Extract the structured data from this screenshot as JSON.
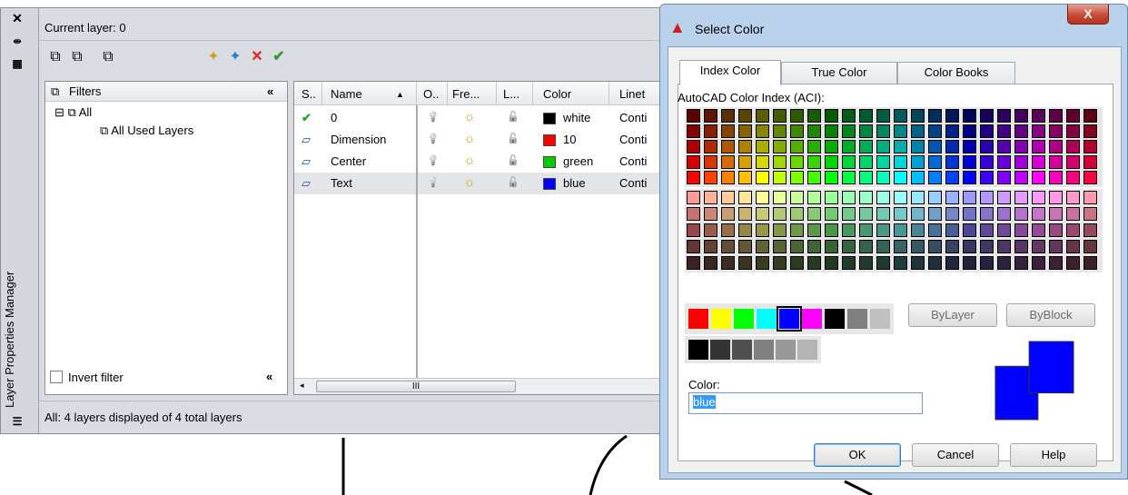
{
  "lpm": {
    "vertical_title": "Layer Properties Manager",
    "current_layer": "Current layer: 0",
    "filters_header": "Filters",
    "tree": {
      "root": "All",
      "child": "All Used Layers"
    },
    "invert_filter": "Invert filter",
    "columns": [
      "S..",
      "Name",
      "O..",
      "Fre...",
      "L...",
      "Color",
      "Linet"
    ],
    "layers": [
      {
        "status": "✔",
        "name": "0",
        "color_name": "white",
        "color_hex": "#000000",
        "linetype": "Conti"
      },
      {
        "status": "▱",
        "name": "Dimension",
        "color_name": "10",
        "color_hex": "#ff0000",
        "linetype": "Conti"
      },
      {
        "status": "▱",
        "name": "Center",
        "color_name": "green",
        "color_hex": "#00cc00",
        "linetype": "Conti"
      },
      {
        "status": "▱",
        "name": "Text",
        "color_name": "blue",
        "color_hex": "#0000ff",
        "linetype": "Conti"
      }
    ],
    "scroll_thumb": "III",
    "status": "All: 4 layers displayed of 4 total layers"
  },
  "dialog": {
    "title": "Select Color",
    "close": "X",
    "tabs": [
      "Index Color",
      "True Color",
      "Color Books"
    ],
    "aci_label": "AutoCAD Color Index (ACI):",
    "bylayer": "ByLayer",
    "byblock": "ByBlock",
    "color_label": "Color:",
    "color_value": "blue",
    "ok": "OK",
    "cancel": "Cancel",
    "help": "Help",
    "standard_colors": [
      "#ff0000",
      "#ffff00",
      "#00ff00",
      "#00ffff",
      "#0000ff",
      "#ff00ff",
      "#000000",
      "#808080",
      "#c0c0c0"
    ],
    "gray_colors": [
      "#000000",
      "#333333",
      "#505050",
      "#808080",
      "#989898",
      "#b4b4b4"
    ],
    "preview_color": "#0000ff"
  }
}
